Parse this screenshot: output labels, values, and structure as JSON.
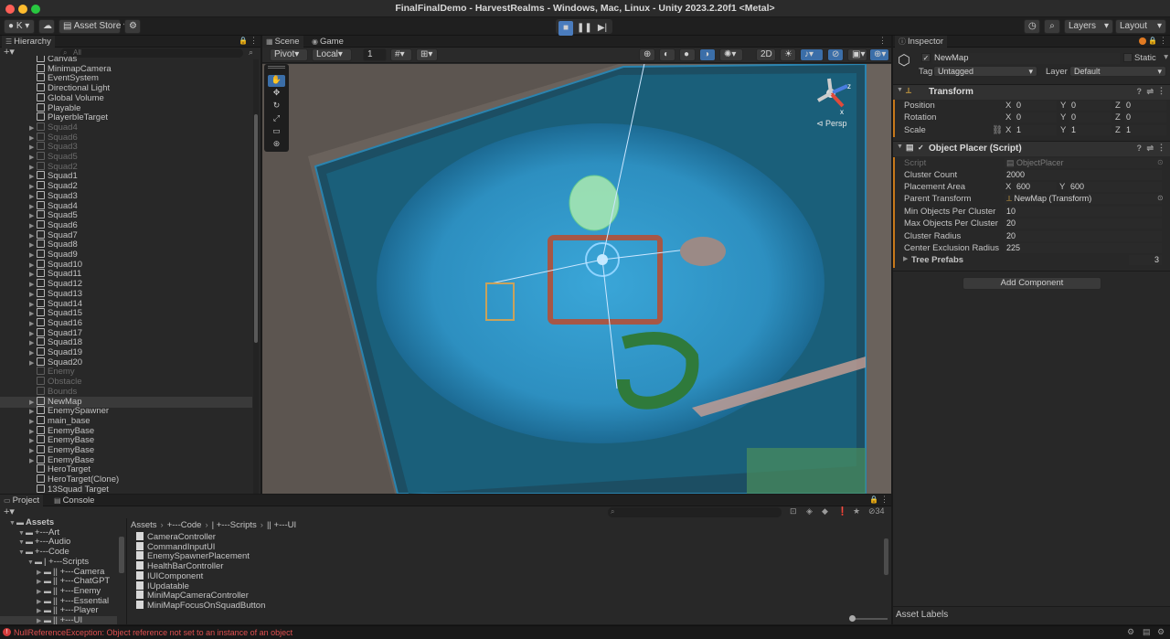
{
  "window": {
    "title": "FinalFinalDemo - HarvestRealms - Windows, Mac, Linux - Unity 2023.2.20f1 <Metal>"
  },
  "toolbar": {
    "account": "K",
    "asset_store": "Asset Store",
    "layers": "Layers",
    "layout": "Layout",
    "play_icons": [
      "stop-icon",
      "pause-icon",
      "step-icon"
    ]
  },
  "hierarchy": {
    "tab": "Hierarchy",
    "search_placeholder": "All",
    "items": [
      {
        "label": "Canvas",
        "dim": false,
        "arrow": false
      },
      {
        "label": "MinimapCamera",
        "dim": false,
        "arrow": false
      },
      {
        "label": "EventSystem",
        "dim": false,
        "arrow": false
      },
      {
        "label": "Directional Light",
        "dim": false,
        "arrow": false
      },
      {
        "label": "Global Volume",
        "dim": false,
        "arrow": false
      },
      {
        "label": "Playable",
        "dim": false,
        "arrow": false
      },
      {
        "label": "PlayerbleTarget",
        "dim": false,
        "arrow": false
      },
      {
        "label": "Squad4",
        "dim": true,
        "arrow": true
      },
      {
        "label": "Squad6",
        "dim": true,
        "arrow": true
      },
      {
        "label": "Squad3",
        "dim": true,
        "arrow": true
      },
      {
        "label": "Squad5",
        "dim": true,
        "arrow": true
      },
      {
        "label": "Squad2",
        "dim": true,
        "arrow": true
      },
      {
        "label": "Squad1",
        "dim": false,
        "arrow": true
      },
      {
        "label": "Squad2",
        "dim": false,
        "arrow": true
      },
      {
        "label": "Squad3",
        "dim": false,
        "arrow": true
      },
      {
        "label": "Squad4",
        "dim": false,
        "arrow": true
      },
      {
        "label": "Squad5",
        "dim": false,
        "arrow": true
      },
      {
        "label": "Squad6",
        "dim": false,
        "arrow": true
      },
      {
        "label": "Squad7",
        "dim": false,
        "arrow": true
      },
      {
        "label": "Squad8",
        "dim": false,
        "arrow": true
      },
      {
        "label": "Squad9",
        "dim": false,
        "arrow": true
      },
      {
        "label": "Squad10",
        "dim": false,
        "arrow": true
      },
      {
        "label": "Squad11",
        "dim": false,
        "arrow": true
      },
      {
        "label": "Squad12",
        "dim": false,
        "arrow": true
      },
      {
        "label": "Squad13",
        "dim": false,
        "arrow": true
      },
      {
        "label": "Squad14",
        "dim": false,
        "arrow": true
      },
      {
        "label": "Squad15",
        "dim": false,
        "arrow": true
      },
      {
        "label": "Squad16",
        "dim": false,
        "arrow": true
      },
      {
        "label": "Squad17",
        "dim": false,
        "arrow": true
      },
      {
        "label": "Squad18",
        "dim": false,
        "arrow": true
      },
      {
        "label": "Squad19",
        "dim": false,
        "arrow": true
      },
      {
        "label": "Squad20",
        "dim": false,
        "arrow": true
      },
      {
        "label": "Enemy",
        "dim": true,
        "arrow": false
      },
      {
        "label": "Obstacle",
        "dim": true,
        "arrow": false
      },
      {
        "label": "Bounds",
        "dim": true,
        "arrow": false
      },
      {
        "label": "NewMap",
        "dim": false,
        "arrow": true,
        "selected": true
      },
      {
        "label": "EnemySpawner",
        "dim": false,
        "arrow": true
      },
      {
        "label": "main_base",
        "dim": false,
        "arrow": true
      },
      {
        "label": "EnemyBase",
        "dim": false,
        "arrow": true
      },
      {
        "label": "EnemyBase",
        "dim": false,
        "arrow": true
      },
      {
        "label": "EnemyBase",
        "dim": false,
        "arrow": true
      },
      {
        "label": "EnemyBase",
        "dim": false,
        "arrow": true
      },
      {
        "label": "HeroTarget",
        "dim": false,
        "arrow": false
      },
      {
        "label": "HeroTarget(Clone)",
        "dim": false,
        "arrow": false
      },
      {
        "label": "13Squad Target",
        "dim": false,
        "arrow": false
      }
    ]
  },
  "scene": {
    "tabs": [
      "Scene",
      "Game"
    ],
    "pivot": "Pivot",
    "local": "Local",
    "grid_value": "1",
    "mode_2d": "2D",
    "persp": "Persp",
    "gizmo_x": "x",
    "gizmo_z": "z",
    "tools": [
      "hand-icon",
      "move-icon",
      "rotate-icon",
      "scale-icon",
      "rect-icon",
      "transform-icon"
    ]
  },
  "inspector": {
    "tab": "Inspector",
    "object_name": "NewMap",
    "static_label": "Static",
    "tag_label": "Tag",
    "tag_value": "Untagged",
    "layer_label": "Layer",
    "layer_value": "Default",
    "transform": {
      "title": "Transform",
      "position_label": "Position",
      "position": [
        "0",
        "0",
        "0"
      ],
      "rotation_label": "Rotation",
      "rotation": [
        "0",
        "0",
        "0"
      ],
      "scale_label": "Scale",
      "scale": [
        "1",
        "1",
        "1"
      ]
    },
    "object_placer": {
      "title": "Object Placer (Script)",
      "script_label": "Script",
      "script_value": "ObjectPlacer",
      "cluster_count_label": "Cluster Count",
      "cluster_count": "2000",
      "placement_area_label": "Placement Area",
      "placement_x": "600",
      "placement_y": "600",
      "parent_transform_label": "Parent Transform",
      "parent_transform": "NewMap (Transform)",
      "min_objects_label": "Min Objects Per Cluster",
      "min_objects": "10",
      "max_objects_label": "Max Objects Per Cluster",
      "max_objects": "20",
      "cluster_radius_label": "Cluster Radius",
      "cluster_radius": "20",
      "center_exclusion_label": "Center Exclusion Radius",
      "center_exclusion": "225",
      "tree_prefabs_label": "Tree Prefabs",
      "tree_prefabs_count": "3"
    },
    "add_component": "Add Component",
    "asset_labels": "Asset Labels"
  },
  "project": {
    "tabs": [
      "Project",
      "Console"
    ],
    "count": "34",
    "breadcrumb": [
      "Assets",
      "+---Code",
      "| +---Scripts",
      "|| +---UI"
    ],
    "tree": [
      {
        "label": "Assets",
        "indent": 0,
        "bold": true
      },
      {
        "label": "+---Art",
        "indent": 1
      },
      {
        "label": "+---Audio",
        "indent": 1
      },
      {
        "label": "+---Code",
        "indent": 1
      },
      {
        "label": "| +---Scripts",
        "indent": 2
      },
      {
        "label": "|| +---Camera",
        "indent": 3
      },
      {
        "label": "|| +---ChatGPT",
        "indent": 3
      },
      {
        "label": "|| +---Enemy",
        "indent": 3
      },
      {
        "label": "|| +---Essential",
        "indent": 3
      },
      {
        "label": "|| +---Player",
        "indent": 3
      },
      {
        "label": "|| +---UI",
        "indent": 3,
        "selected": true
      }
    ],
    "files": [
      "CameraController",
      "CommandInputUI",
      "EnemySpawnerPlacement",
      "HealthBarController",
      "IUIComponent",
      "IUpdatable",
      "MiniMapCameraController",
      "MiniMapFocusOnSquadButton"
    ]
  },
  "status": {
    "error": "NullReferenceException: Object reference not set to an instance of an object",
    "error_color": "#e05050"
  },
  "colors": {
    "accent": "#3b6ea8",
    "selection": "#2c5d87",
    "component_bar": "#c7781a"
  }
}
